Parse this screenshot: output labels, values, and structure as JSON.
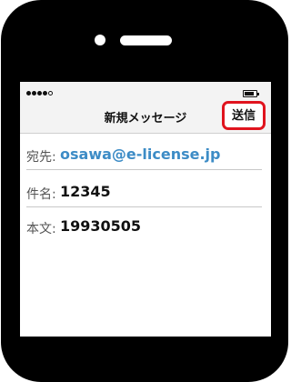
{
  "status_bar": {
    "signal_dots": 5,
    "signal_filled": 4
  },
  "nav": {
    "title": "新規メッセージ",
    "send_label": "送信",
    "highlight_color": "#e0141e"
  },
  "fields": {
    "to_label": "宛先:",
    "to_value": "osawa@e-license.jp",
    "subject_label": "件名:",
    "subject_value": "12345",
    "body_label": "本文:",
    "body_value": "19930505"
  },
  "colors": {
    "recipient_text": "#3d8cc6"
  }
}
